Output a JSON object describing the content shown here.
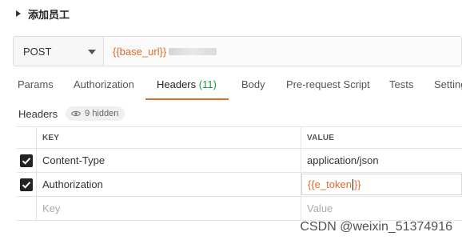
{
  "request": {
    "name": "添加员工"
  },
  "url_bar": {
    "method": "POST",
    "url_variable": "{{base_url}}"
  },
  "tabs": [
    {
      "label": "Params"
    },
    {
      "label": "Authorization"
    },
    {
      "label": "Headers",
      "count": "(11)",
      "active": true
    },
    {
      "label": "Body"
    },
    {
      "label": "Pre-request Script"
    },
    {
      "label": "Tests"
    },
    {
      "label": "Settings"
    }
  ],
  "headers_section": {
    "title": "Headers",
    "hidden_label": "9 hidden"
  },
  "table": {
    "columns": {
      "key": "KEY",
      "value": "VALUE"
    },
    "rows": [
      {
        "key": "Content-Type",
        "value": "application/json",
        "checked": true
      },
      {
        "key": "Authorization",
        "value_before_cursor": "{{e_token",
        "value_after_cursor": "}}",
        "checked": true
      }
    ],
    "new_row": {
      "key_placeholder": "Key",
      "value_placeholder": "Value"
    }
  },
  "watermark": "CSDN @weixin_51374916",
  "colors": {
    "accent": "#e06a27",
    "count": "#1e9a42",
    "checkbox": "#222222"
  },
  "icons": {
    "collapse": "caret-right-icon",
    "method": "chevron-down-icon",
    "hidden": "eye-icon",
    "check": "checkmark-icon"
  }
}
